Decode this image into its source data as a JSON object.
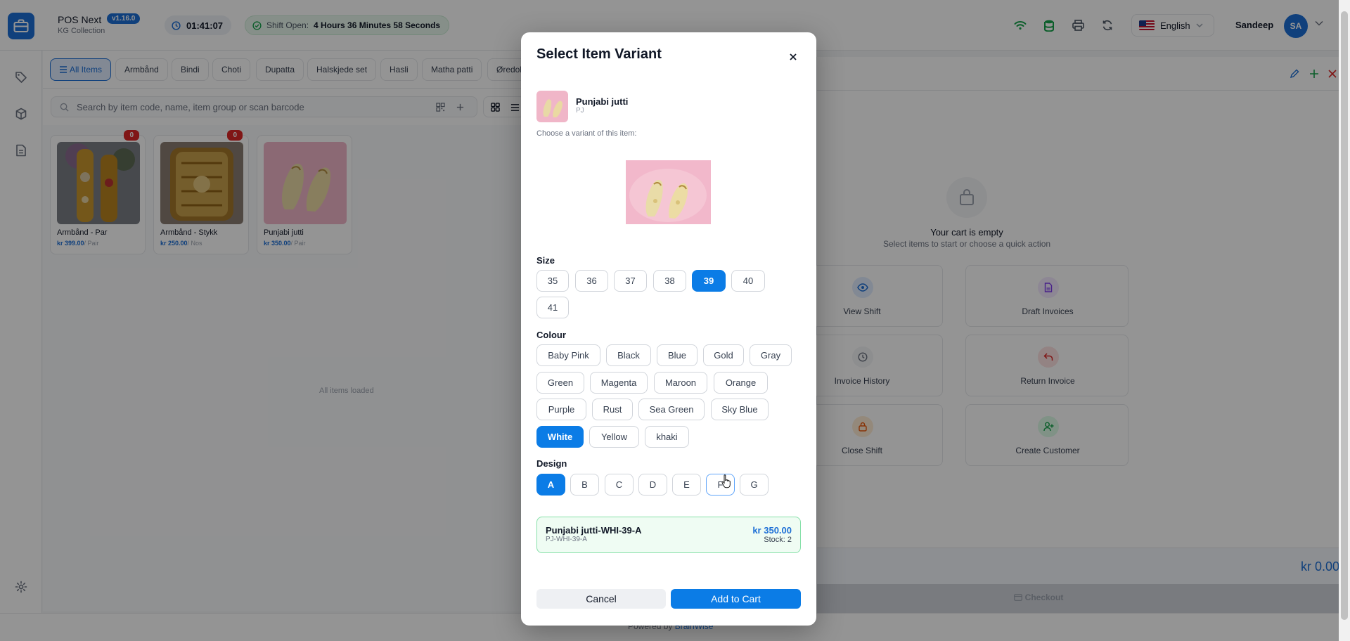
{
  "header": {
    "app_name": "POS Next",
    "version": "v1.16.0",
    "store": "KG Collection",
    "timer": "01:41:07",
    "shift_label": "Shift Open:",
    "shift_duration": "4 Hours 36 Minutes 58 Seconds",
    "language": "English",
    "user_name": "Sandeep",
    "user_initials": "SA"
  },
  "categories": [
    {
      "label": "All Items",
      "active": true
    },
    {
      "label": "Armbånd"
    },
    {
      "label": "Bindi"
    },
    {
      "label": "Choti"
    },
    {
      "label": "Dupatta"
    },
    {
      "label": "Halskjede set"
    },
    {
      "label": "Hasli"
    },
    {
      "label": "Matha patti"
    },
    {
      "label": "Øredob"
    }
  ],
  "search": {
    "placeholder": "Search by item code, name, item group or scan barcode"
  },
  "items": [
    {
      "name": "Armbånd - Par",
      "price": "kr 399.00",
      "unit": "/ Pair",
      "badge": "0"
    },
    {
      "name": "Armbånd - Stykk",
      "price": "kr 250.00",
      "unit": "/ Nos",
      "badge": "0"
    },
    {
      "name": "Punjabi jutti",
      "price": "kr 350.00",
      "unit": "/ Pair"
    }
  ],
  "items_status": "All items loaded",
  "cart": {
    "empty_title": "Your cart is empty",
    "empty_subtitle": "Select items to start or choose a quick action",
    "quick_actions": [
      {
        "label": "View Shift",
        "icon": "eye-icon",
        "color": "#1d6fd6"
      },
      {
        "label": "Draft Invoices",
        "icon": "document-icon",
        "color": "#7c3aed"
      },
      {
        "label": "Invoice History",
        "icon": "clock-icon",
        "color": "#6b7280"
      },
      {
        "label": "Return Invoice",
        "icon": "return-arrow-icon",
        "color": "#dc2626"
      },
      {
        "label": "Close Shift",
        "icon": "lock-icon",
        "color": "#ea580c"
      },
      {
        "label": "Create Customer",
        "icon": "user-plus-icon",
        "color": "#16a34a"
      }
    ],
    "total": "kr 0.00",
    "checkout_label": "Checkout"
  },
  "footer": {
    "powered_by": "Powered by",
    "brand": "BrainWise"
  },
  "modal": {
    "title": "Select Item Variant",
    "item_name": "Punjabi jutti",
    "item_code": "PJ",
    "choose_text": "Choose a variant of this item:",
    "attributes": [
      {
        "label": "Size",
        "options": [
          "35",
          "36",
          "37",
          "38",
          "39",
          "40",
          "41"
        ],
        "selected": "39"
      },
      {
        "label": "Colour",
        "options": [
          "Baby Pink",
          "Black",
          "Blue",
          "Gold",
          "Gray",
          "Green",
          "Magenta",
          "Maroon",
          "Orange",
          "Purple",
          "Rust",
          "Sea Green",
          "Sky Blue",
          "White",
          "Yellow",
          "khaki"
        ],
        "selected": "White"
      },
      {
        "label": "Design",
        "options": [
          "A",
          "B",
          "C",
          "D",
          "E",
          "F",
          "G"
        ],
        "selected": "A",
        "hovered": "F"
      }
    ],
    "variant": {
      "name": "Punjabi jutti-WHI-39-A",
      "code": "PJ-WHI-39-A",
      "price": "kr 350.00",
      "stock": "Stock: 2"
    },
    "cancel_label": "Cancel",
    "add_label": "Add to Cart"
  }
}
